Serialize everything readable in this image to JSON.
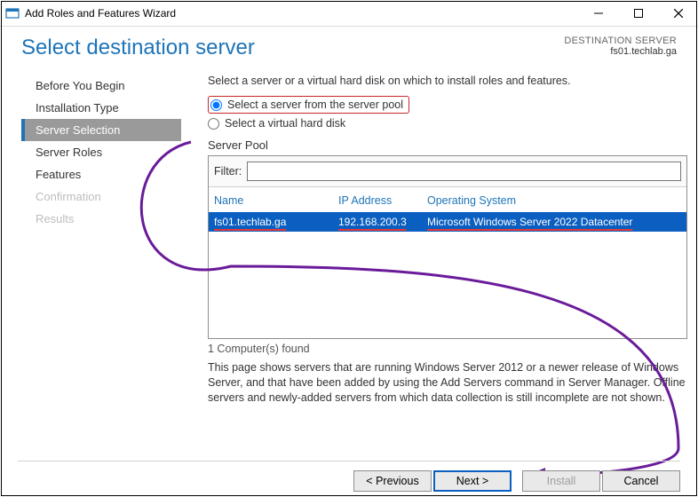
{
  "window": {
    "title": "Add Roles and Features Wizard"
  },
  "header": {
    "title": "Select destination server",
    "destLabel": "DESTINATION SERVER",
    "destValue": "fs01.techlab.ga"
  },
  "nav": {
    "items": [
      {
        "label": "Before You Begin",
        "state": "normal"
      },
      {
        "label": "Installation Type",
        "state": "normal"
      },
      {
        "label": "Server Selection",
        "state": "active"
      },
      {
        "label": "Server Roles",
        "state": "normal"
      },
      {
        "label": "Features",
        "state": "normal"
      },
      {
        "label": "Confirmation",
        "state": "disabled"
      },
      {
        "label": "Results",
        "state": "disabled"
      }
    ]
  },
  "main": {
    "instruction": "Select a server or a virtual hard disk on which to install roles and features.",
    "radio1": "Select a server from the server pool",
    "radio2": "Select a virtual hard disk",
    "poolLabel": "Server Pool",
    "filterLabel": "Filter:",
    "filterValue": "",
    "columns": {
      "name": "Name",
      "ip": "IP Address",
      "os": "Operating System"
    },
    "row": {
      "name": "fs01.techlab.ga",
      "ip": "192.168.200.3",
      "os": "Microsoft Windows Server 2022 Datacenter"
    },
    "found": "1 Computer(s) found",
    "description": "This page shows servers that are running Windows Server 2012 or a newer release of Windows Server, and that have been added by using the Add Servers command in Server Manager. Offline servers and newly-added servers from which data collection is still incomplete are not shown."
  },
  "buttons": {
    "prev": "< Previous",
    "next": "Next >",
    "install": "Install",
    "cancel": "Cancel"
  }
}
